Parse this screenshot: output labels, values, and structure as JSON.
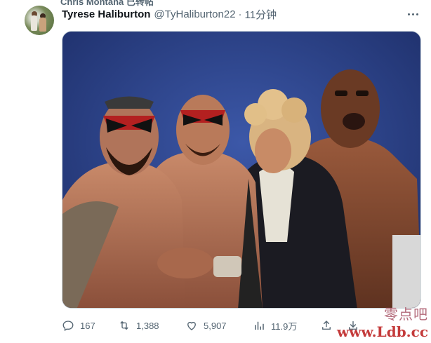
{
  "repost": {
    "text": "Chris Montana 已转帖"
  },
  "author": {
    "name": "Tyrese Haliburton",
    "handle": "@TyHaliburton22",
    "separator": "·",
    "time": "11分钟"
  },
  "media": {},
  "actions": {
    "reply": {
      "icon": "reply-icon",
      "count": "167"
    },
    "repost": {
      "icon": "repost-icon",
      "count": "1,388"
    },
    "like": {
      "icon": "heart-icon",
      "count": "5,907"
    },
    "views": {
      "icon": "views-chart-icon",
      "count": "11.9万"
    },
    "share": {
      "icon": "share-icon"
    },
    "bookmark": {
      "icon": "bookmark-icon"
    }
  },
  "watermark": {
    "text": "零点吧",
    "url": "www.Ldb.cc"
  },
  "colors": {
    "secondary_text": "#536471",
    "primary_text": "#0f1419",
    "media_bg": "#2c3e84"
  }
}
